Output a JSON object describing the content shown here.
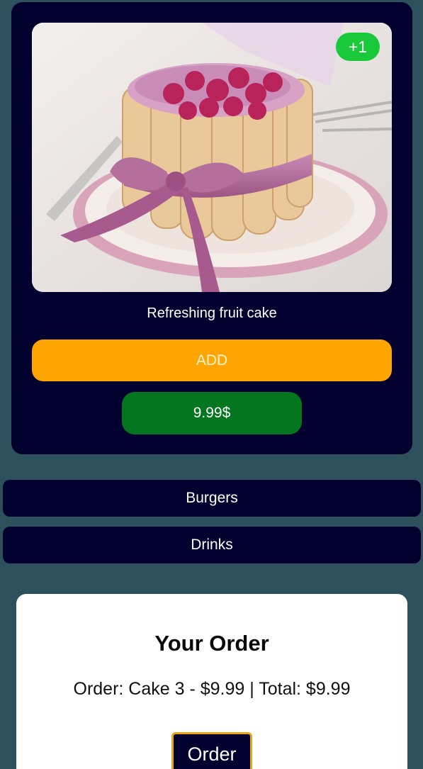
{
  "product": {
    "badge": "+1",
    "name": "Refreshing fruit cake",
    "add_label": "ADD",
    "price": "9.99$",
    "image": "cake-photo"
  },
  "categories": [
    {
      "label": "Burgers"
    },
    {
      "label": "Drinks"
    }
  ],
  "order": {
    "title": "Your Order",
    "summary": "Order: Cake 3 - $9.99 | Total: $9.99",
    "button_label": "Order"
  },
  "colors": {
    "background": "#2e4f5c",
    "card": "#01002e",
    "add": "#ffa502",
    "price": "#03761f",
    "badge": "#19c93a",
    "order_border": "#e8a515"
  }
}
